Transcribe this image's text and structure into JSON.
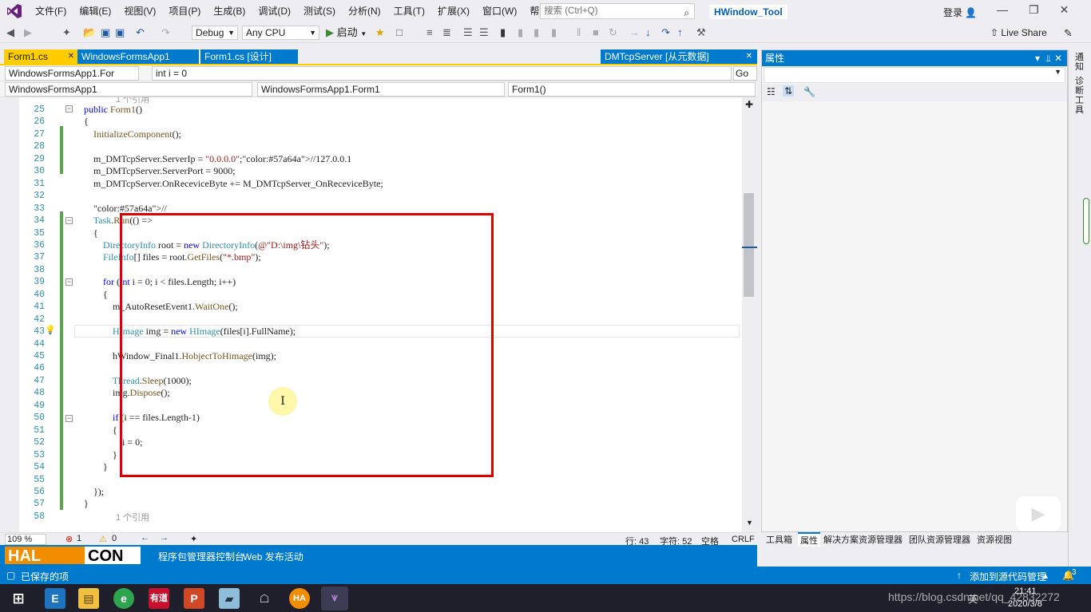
{
  "menubar": {
    "items": [
      "文件(F)",
      "编辑(E)",
      "视图(V)",
      "项目(P)",
      "生成(B)",
      "调试(D)",
      "测试(S)",
      "分析(N)",
      "工具(T)",
      "扩展(X)",
      "窗口(W)",
      "帮助(H)"
    ],
    "search_placeholder": "搜索 (Ctrl+Q)",
    "solution_title": "HWindow_Tool",
    "login": "登录"
  },
  "toolbar": {
    "config": "Debug",
    "platform": "Any CPU",
    "start": "启动",
    "live_share": "Live Share"
  },
  "tabs": {
    "active": "Form1.cs",
    "app": "WindowsFormsApp1",
    "design": "Form1.cs [设计]",
    "tcp": "DMTcpServer [从元数据]"
  },
  "nav": {
    "scope1": "WindowsFormsApp1.For",
    "member1": "int i = 0",
    "go": "Go",
    "project": "WindowsFormsApp1",
    "class": "WindowsFormsApp1.Form1",
    "method": "Form1()"
  },
  "code": {
    "lines": [
      {
        "n": "25",
        "text": "    public Form1()",
        "lens": "1 个引用"
      },
      {
        "n": "26",
        "text": "    {"
      },
      {
        "n": "27",
        "text": "        InitializeComponent();"
      },
      {
        "n": "28",
        "text": ""
      },
      {
        "n": "29",
        "text": "        m_DMTcpServer.ServerIp = \"0.0.0.0\";//127.0.0.1"
      },
      {
        "n": "30",
        "text": "        m_DMTcpServer.ServerPort = 9000;"
      },
      {
        "n": "31",
        "text": "        m_DMTcpServer.OnReceviceByte += M_DMTcpServer_OnReceviceByte;"
      },
      {
        "n": "32",
        "text": ""
      },
      {
        "n": "33",
        "text": "        //"
      },
      {
        "n": "34",
        "text": "        Task.Run(() =>"
      },
      {
        "n": "35",
        "text": "        {"
      },
      {
        "n": "36",
        "text": "            DirectoryInfo root = new DirectoryInfo(@\"D:\\img\\钻头\");"
      },
      {
        "n": "37",
        "text": "            FileInfo[] files = root.GetFiles(\"*.bmp\");"
      },
      {
        "n": "38",
        "text": ""
      },
      {
        "n": "39",
        "text": "            for (int i = 0; i < files.Length; i++)"
      },
      {
        "n": "40",
        "text": "            {"
      },
      {
        "n": "41",
        "text": "                m_AutoResetEvent1.WaitOne();"
      },
      {
        "n": "42",
        "text": ""
      },
      {
        "n": "43",
        "text": "                HImage img = new HImage(files[i].FullName);"
      },
      {
        "n": "44",
        "text": ""
      },
      {
        "n": "45",
        "text": "                hWindow_Final1.HobjectToHimage(img);"
      },
      {
        "n": "46",
        "text": ""
      },
      {
        "n": "47",
        "text": "                Thread.Sleep(1000);"
      },
      {
        "n": "48",
        "text": "                img.Dispose();"
      },
      {
        "n": "49",
        "text": ""
      },
      {
        "n": "50",
        "text": "                if (i == files.Length-1)"
      },
      {
        "n": "51",
        "text": "                {"
      },
      {
        "n": "52",
        "text": "                    i = 0;"
      },
      {
        "n": "53",
        "text": "                }"
      },
      {
        "n": "54",
        "text": "            }"
      },
      {
        "n": "55",
        "text": ""
      },
      {
        "n": "56",
        "text": "        });"
      },
      {
        "n": "57",
        "text": "    }"
      },
      {
        "n": "58",
        "text": "",
        "lens": "1 个引用"
      }
    ]
  },
  "status_line": {
    "zoom": "109 %",
    "errors": "1",
    "warnings": "0",
    "row": "行: 43",
    "col": "字符: 52",
    "ws": "空格",
    "eol": "CRLF"
  },
  "bottom_tabs": [
    "程序包管理器控制台",
    "Web 发布活动"
  ],
  "statusbar": {
    "saved": "已保存的项",
    "source_control": "添加到源代码管理",
    "notifications": "3"
  },
  "props": {
    "title": "属性",
    "tabs": [
      "工具箱",
      "属性",
      "解决方案资源管理器",
      "团队资源管理器",
      "资源视图"
    ]
  },
  "right_strip": [
    "通知",
    "诊断工具"
  ],
  "taskbar": {
    "url_overlay": "https://blog.csdn.net/qq_42832272",
    "time": "21:41",
    "date": "2020/3/8",
    "lang": "英"
  },
  "halcon_logo": "HALCON",
  "colors": {
    "accent": "#007acc",
    "tab_active": "#ffcc00",
    "highlight": "#e00000",
    "keyword": "#0000ff",
    "type": "#2b91af",
    "string": "#a31515"
  }
}
